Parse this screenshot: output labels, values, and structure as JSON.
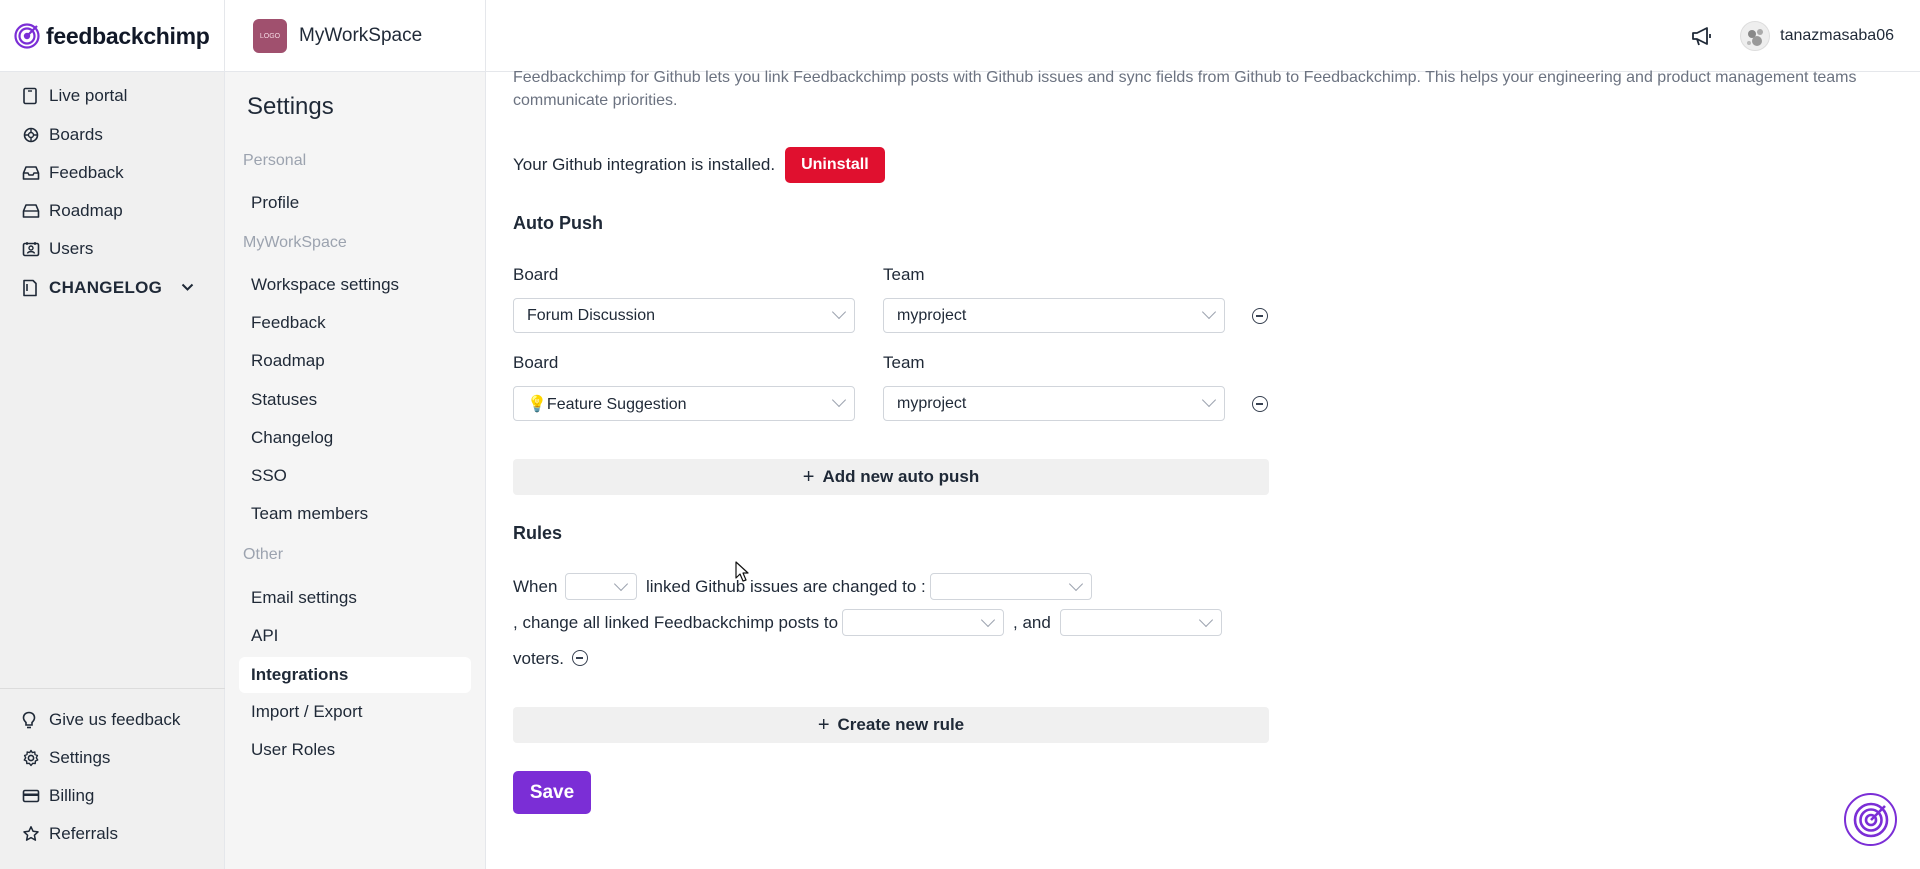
{
  "brand": {
    "name": "feedbackchimp",
    "accent": "#7b2ed6"
  },
  "workspace": {
    "name": "MyWorkSpace",
    "logo_text": "LOGO"
  },
  "topbar": {
    "username": "tanazmasaba06",
    "announce_icon": "megaphone-icon"
  },
  "sidebar": {
    "items": [
      {
        "label": "Live portal",
        "icon": "portal-icon"
      },
      {
        "label": "Boards",
        "icon": "boards-icon"
      },
      {
        "label": "Feedback",
        "icon": "inbox-icon"
      },
      {
        "label": "Roadmap",
        "icon": "roadmap-icon"
      },
      {
        "label": "Users",
        "icon": "users-icon"
      },
      {
        "label": "CHANGELOG",
        "icon": "changelog-icon"
      }
    ],
    "bottom_items": [
      {
        "label": "Give us feedback",
        "icon": "bulb-icon"
      },
      {
        "label": "Settings",
        "icon": "gear-icon"
      },
      {
        "label": "Billing",
        "icon": "card-icon"
      },
      {
        "label": "Referrals",
        "icon": "star-icon"
      }
    ]
  },
  "settings": {
    "title": "Settings",
    "sections": {
      "personal": "Personal",
      "workspace": "MyWorkSpace",
      "other": "Other"
    },
    "personal_items": [
      "Profile"
    ],
    "workspace_items": [
      "Workspace settings",
      "Feedback",
      "Roadmap",
      "Statuses",
      "Changelog",
      "SSO",
      "Team members"
    ],
    "other_items": [
      "Email settings",
      "API",
      "Integrations",
      "Import / Export",
      "User Roles"
    ],
    "active": "Integrations"
  },
  "main": {
    "description": "Feedbackchimp for Github lets you link Feedbackchimp posts with Github issues and sync fields from Github to Feedbackchimp. This helps your engineering and product management teams communicate priorities.",
    "installed_text": "Your Github integration is installed.",
    "uninstall_label": "Uninstall",
    "auto_push": {
      "title": "Auto Push",
      "board_label": "Board",
      "team_label": "Team",
      "rows": [
        {
          "board": "Forum Discussion",
          "team": "myproject"
        },
        {
          "board": "💡Feature Suggestion",
          "team": "myproject"
        }
      ],
      "add_label": "Add new auto push"
    },
    "rules": {
      "title": "Rules",
      "when": "When",
      "linked_text": "linked Github issues are changed to :",
      "change_text": ", change all linked Feedbackchimp posts to",
      "and_text": ", and",
      "voters_text": "voters.",
      "create_label": "Create new rule"
    },
    "save_label": "Save"
  }
}
